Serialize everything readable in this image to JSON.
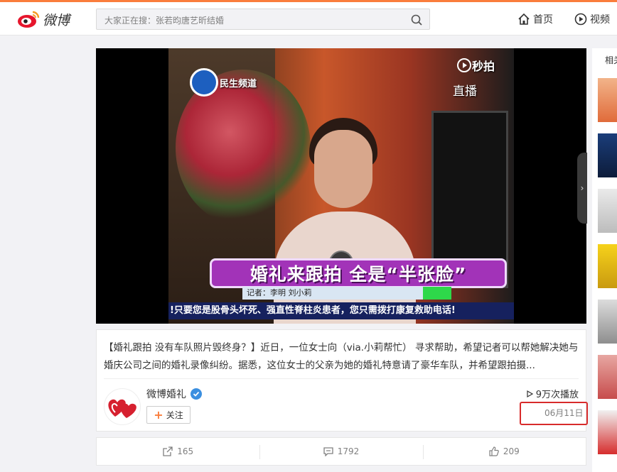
{
  "header": {
    "logo_text": "微博",
    "search_placeholder": "大家正在搜：张若昀唐艺昕结婚",
    "nav": [
      {
        "label": "首页",
        "icon": "home-icon"
      },
      {
        "label": "视频",
        "icon": "video-play-icon"
      }
    ]
  },
  "video": {
    "channel_name": "民生频道",
    "watermark": "秒拍",
    "live_label": "直播",
    "headline": "婚礼来跟拍  全是“半张脸”",
    "reporter_line": "记者：李明  刘小莉",
    "ticker": "!只要您是股骨头坏死、强直性脊柱炎患者，您只需拨打康复救助电话!"
  },
  "post": {
    "description": "【婚礼跟拍 没有车队照片毁终身？】近日，一位女士向（via.小莉帮忙） 寻求帮助，希望记者可以帮她解决她与婚庆公司之间的婚礼录像纠纷。据悉，这位女士的父亲为她的婚礼特意请了豪华车队，并希望跟拍摄...",
    "author": "微博婚礼",
    "follow_label": "关注",
    "plays": "9万次播放",
    "date": "06月11日"
  },
  "actions": [
    {
      "name": "share",
      "count": "165"
    },
    {
      "name": "comment",
      "count": "1792"
    },
    {
      "name": "like",
      "count": "209"
    }
  ],
  "sidebar": {
    "title": "相关"
  },
  "colors": {
    "accent": "#fa7d3c",
    "highlight_box": "#d82b2b",
    "verified": "#3b8fe0"
  }
}
